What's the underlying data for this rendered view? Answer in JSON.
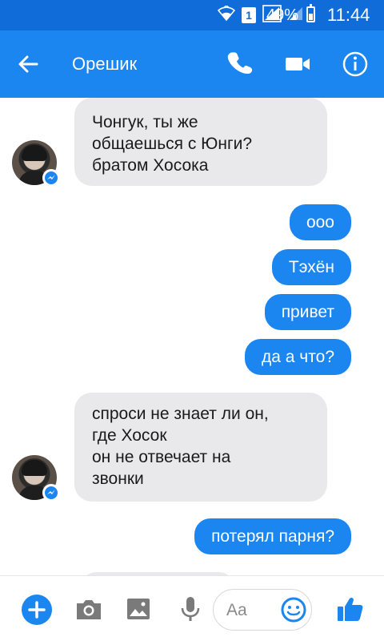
{
  "status_bar": {
    "battery_percent": "49%",
    "time": "11:44",
    "sim_slot": "1"
  },
  "header": {
    "contact_name": "Орешик"
  },
  "messages": [
    {
      "direction": "incoming",
      "text": "Чонгук, ты же\nобщаешься с Юнги?\nбратом Хосока"
    },
    {
      "direction": "outgoing",
      "text": "ооо"
    },
    {
      "direction": "outgoing",
      "text": "Тэхён"
    },
    {
      "direction": "outgoing",
      "text": "привет"
    },
    {
      "direction": "outgoing",
      "text": "да а что?"
    },
    {
      "direction": "incoming",
      "text": "спроси не знает ли он,\nгде Хосок\nон не отвечает на\nзвонки"
    },
    {
      "direction": "outgoing",
      "text": "потерял парня?"
    }
  ],
  "composer": {
    "placeholder": "Aa"
  },
  "colors": {
    "status_bar": "#0F6CD9",
    "app_bar": "#1B86F0",
    "incoming_bubble": "#E9E9EB",
    "outgoing_bubble": "#1B86F0"
  },
  "icons": [
    "wifi-icon",
    "sim-icon",
    "signal-icon",
    "battery-icon",
    "back-arrow-icon",
    "phone-icon",
    "video-camera-icon",
    "info-icon",
    "plus-icon",
    "camera-icon",
    "gallery-icon",
    "mic-icon",
    "emoji-icon",
    "thumbs-up-icon",
    "messenger-badge-icon"
  ]
}
